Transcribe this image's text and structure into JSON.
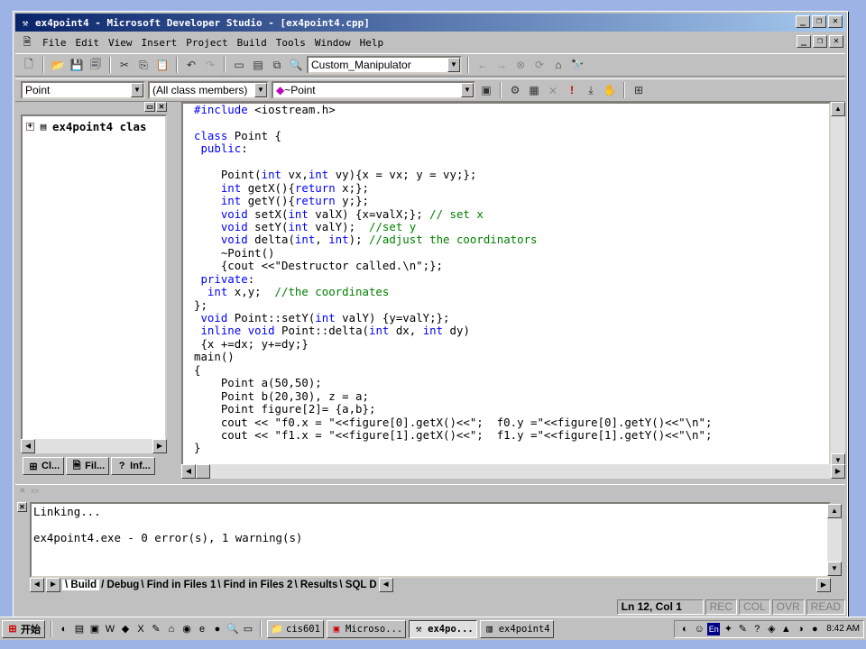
{
  "window": {
    "title": "ex4point4 - Microsoft Developer Studio - [ex4point4.cpp]",
    "controls": [
      "_",
      "❐",
      "✕"
    ]
  },
  "menu": {
    "items": [
      "File",
      "Edit",
      "View",
      "Insert",
      "Project",
      "Build",
      "Tools",
      "Window",
      "Help"
    ]
  },
  "toolbar1": {
    "find_combo": "Custom_Manipulator"
  },
  "toolbar2": {
    "class_combo": "Point",
    "members_combo": "(All class members)",
    "function_combo": "~Point"
  },
  "workspace": {
    "tree_root": "ex4point4 clas",
    "tabs": [
      "Cl...",
      "Fil...",
      "Inf..."
    ]
  },
  "code": {
    "lines": [
      "#include <iostream.h>",
      "",
      "class Point {",
      " public:",
      "",
      "    Point(int vx,int vy){x = vx; y = vy;};",
      "    int getX(){return x;};",
      "    int getY(){return y;};",
      "    void setX(int valX) {x=valX;}; // set x",
      "    void setY(int valY);  //set y",
      "    void delta(int, int); //adjust the coordinators",
      "    ~Point()",
      "    {cout <<\"Destructor called.\\n\";};",
      " private:",
      "  int x,y;  //the coordinates",
      "};",
      " void Point::setY(int valY) {y=valY;};",
      " inline void Point::delta(int dx, int dy)",
      " {x +=dx; y+=dy;}",
      "main()",
      "{",
      "    Point a(50,50);",
      "    Point b(20,30), z = a;",
      "    Point figure[2]= {a,b};",
      "    cout << \"f0.x = \"<<figure[0].getX()<<\";  f0.y =\"<<figure[0].getY()<<\"\\n\";",
      "    cout << \"f1.x = \"<<figure[1].getX()<<\";  f1.y =\"<<figure[1].getY()<<\"\\n\";",
      "}"
    ]
  },
  "output": {
    "lines": [
      "Linking...",
      "",
      "ex4point4.exe - 0 error(s), 1 warning(s)"
    ],
    "tabs": [
      "Build",
      "Debug",
      "Find in Files 1",
      "Find in Files 2",
      "Results",
      "SQL D"
    ]
  },
  "status": {
    "position": "Ln 12, Col 1",
    "indicators": [
      "REC",
      "COL",
      "OVR",
      "READ"
    ]
  },
  "taskbar": {
    "start": "开始",
    "tasks": [
      "cis601",
      "Microso...",
      "ex4po...",
      "ex4point4"
    ],
    "clock": "8:42 AM"
  }
}
